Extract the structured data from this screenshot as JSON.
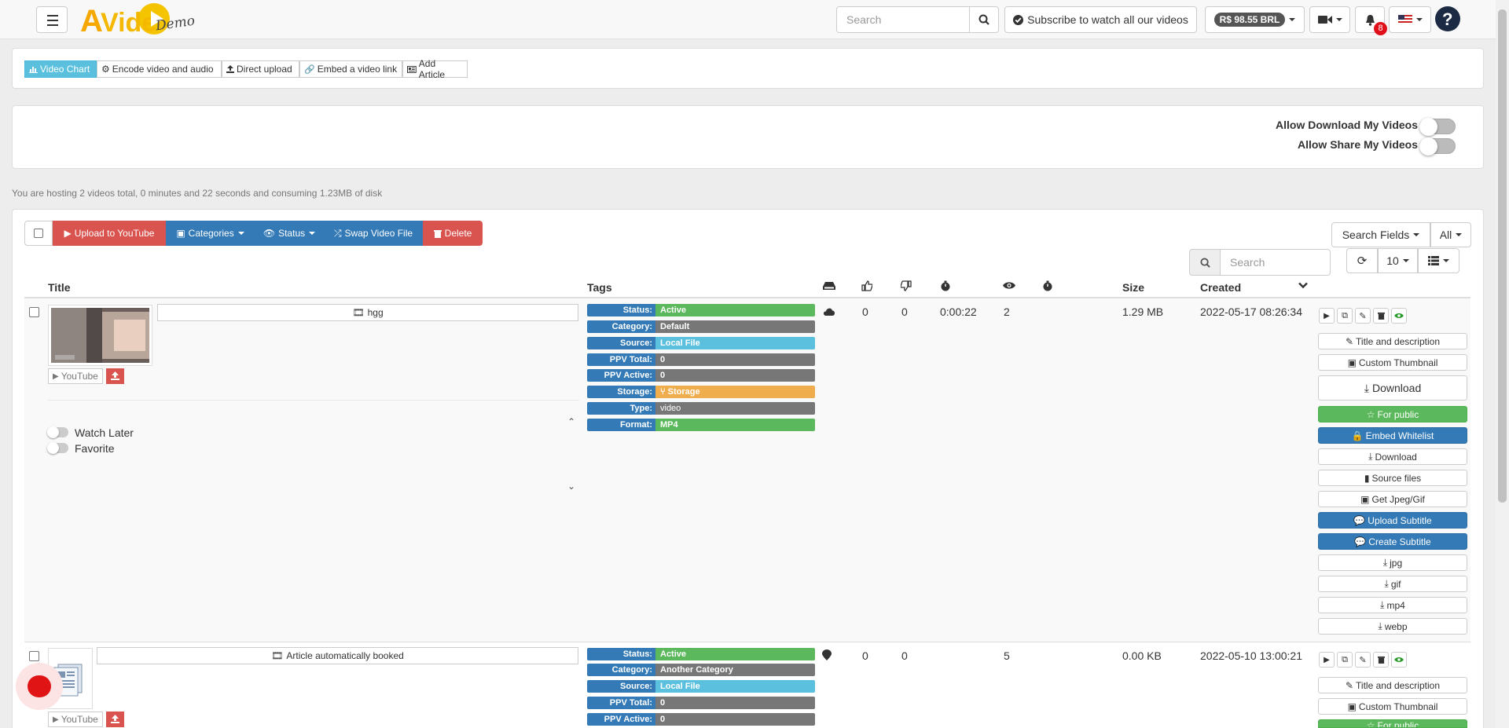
{
  "nav": {
    "search_placeholder": "Search",
    "subscribe_label": "Subscribe to watch all our videos",
    "balance": "R$ 98.55 BRL",
    "notification_count": "8",
    "logo_sub": "Demo"
  },
  "tabs": [
    "Video Chart",
    "Encode video and audio",
    "Direct upload",
    "Embed a video link",
    "Add Article"
  ],
  "toggles": {
    "allow_download": "Allow Download My Videos",
    "allow_share": "Allow Share My Videos"
  },
  "host_info": "You are hosting 2 videos total, 0 minutes and 22 seconds and consuming 1.23MB of disk",
  "toolbar": {
    "upload_youtube": "Upload to YouTube",
    "categories": "Categories",
    "status": "Status",
    "swap": "Swap Video File",
    "delete": "Delete",
    "search_fields": "Search Fields",
    "all": "All",
    "search_placeholder": "Search",
    "page_size": "10"
  },
  "columns": {
    "title": "Title",
    "tags": "Tags",
    "size": "Size",
    "created": "Created"
  },
  "rows": [
    {
      "title": "hgg",
      "youtube": "YouTube",
      "watch_later": "Watch Later",
      "favorite": "Favorite",
      "tags": [
        {
          "k": "Status:",
          "v": "Active"
        },
        {
          "k": "Category:",
          "v": "Default"
        },
        {
          "k": "Source:",
          "v": "Local File"
        },
        {
          "k": "PPV Total:",
          "v": "0"
        },
        {
          "k": "PPV Active:",
          "v": "0"
        },
        {
          "k": "Storage:",
          "v": "Storage"
        },
        {
          "k": "Type:",
          "v": "video"
        },
        {
          "k": "Format:",
          "v": "MP4"
        }
      ],
      "likes": "0",
      "dislikes": "0",
      "duration": "0:00:22",
      "views": "2",
      "size": "1.29 MB",
      "created": "2022-05-17 08:26:34",
      "actions": [
        "Title and description",
        "Custom Thumbnail",
        "Download",
        "For public",
        "Embed Whitelist",
        "Download",
        "Source files",
        "Get Jpeg/Gif",
        "Upload Subtitle",
        "Create Subtitle",
        "jpg",
        "gif",
        "mp4",
        "webp"
      ]
    },
    {
      "title": "Article automatically booked",
      "youtube": "YouTube",
      "tags": [
        {
          "k": "Status:",
          "v": "Active"
        },
        {
          "k": "Category:",
          "v": "Another Category"
        },
        {
          "k": "Source:",
          "v": "Local File"
        },
        {
          "k": "PPV Total:",
          "v": "0"
        },
        {
          "k": "PPV Active:",
          "v": "0"
        }
      ],
      "likes": "0",
      "dislikes": "0",
      "views": "5",
      "size": "0.00 KB",
      "created": "2022-05-10 13:00:21",
      "actions": [
        "Title and description",
        "Custom Thumbnail",
        "For public"
      ]
    }
  ],
  "colors": {
    "tag_key": "#337ab7",
    "active": "#5cb85c",
    "grey": "#777777",
    "info": "#5bc0de",
    "storage": "#f0ad4e",
    "danger": "#d9534f"
  }
}
